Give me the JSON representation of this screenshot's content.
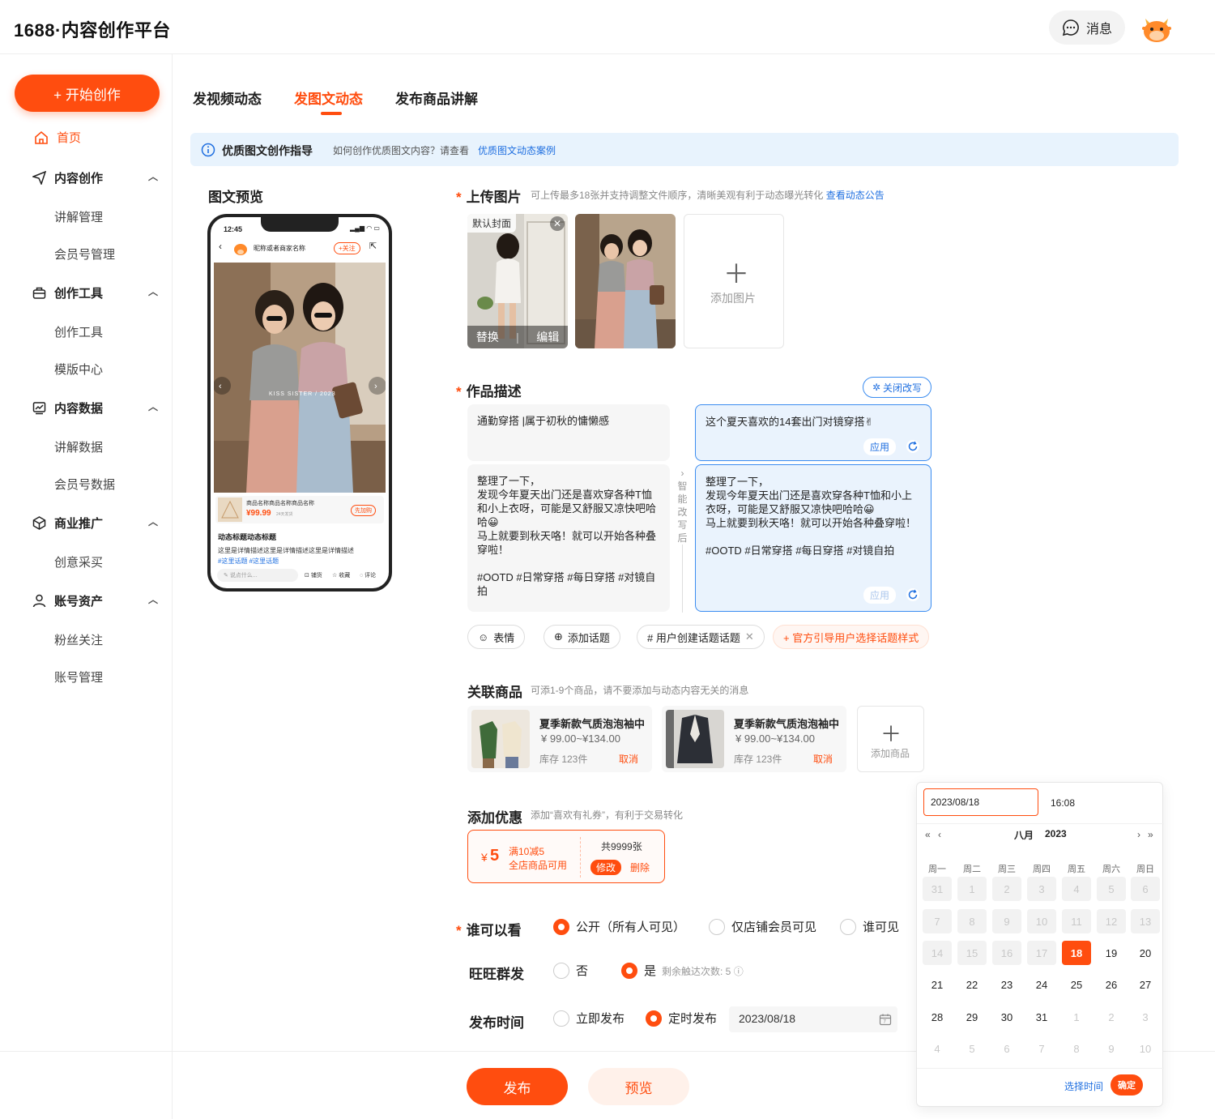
{
  "brand": "1688·内容创作平台",
  "header": {
    "message_label": "消息"
  },
  "sidebar": {
    "start_label": "+ 开始创作",
    "home": "首页",
    "groups": [
      {
        "label": "内容创作",
        "items": [
          "讲解管理",
          "会员号管理"
        ]
      },
      {
        "label": "创作工具",
        "items": [
          "创作工具",
          "模版中心"
        ]
      },
      {
        "label": "内容数据",
        "items": [
          "讲解数据",
          "会员号数据"
        ]
      },
      {
        "label": "商业推广",
        "items": [
          "创意采买"
        ]
      },
      {
        "label": "账号资产",
        "items": [
          "粉丝关注",
          "账号管理"
        ]
      }
    ]
  },
  "tabs": [
    "发视频动态",
    "发图文动态",
    "发布商品讲解"
  ],
  "notice": {
    "title": "优质图文创作指导",
    "text": "如何创作优质图文内容？请查看",
    "link": "优质图文动态案例"
  },
  "preview": {
    "title": "图文预览",
    "time": "12:45",
    "shop_name": "昵称或者商家名称",
    "follow": "+关注",
    "photo_text": "KISS SISTER / 2023",
    "product_name": "商品名称商品名称商品名称",
    "product_price": "¥99.99",
    "product_sub": "24天发货",
    "buy": "先加购",
    "post_title": "动态标题动态标题",
    "post_desc": "这里是详情描述这里是详情描述这里是详情描述",
    "post_tags": "#这里话题 #这里话题",
    "comment_placeholder": "说点什么...",
    "actions": [
      "铺货",
      "收藏",
      "评论"
    ]
  },
  "upload": {
    "label": "上传图片",
    "hint": "可上传最多18张并支持调整文件顺序，清晰美观有利于动态曝光转化",
    "hint_link": "查看动态公告",
    "cover_tag": "默认封面",
    "replace": "替换",
    "edit": "编辑",
    "add_label": "添加图片"
  },
  "desc": {
    "label": "作品描述",
    "close_rewrite": "关闭改写",
    "title_input": "通勤穿搭 |属于初秋的慵懒感",
    "title_suggest": "这个夏天喜欢的14套出门对镜穿搭✌",
    "body_input": [
      "整理了一下，",
      "发现今年夏天出门还是喜欢穿各种T恤和小上衣呀，可能是又舒服又凉快吧哈哈😀",
      "马上就要到秋天咯！就可以开始各种叠穿啦！",
      "",
      "#OOTD #日常穿搭 #每日穿搭 #对镜自拍"
    ],
    "body_suggest": [
      "整理了一下，",
      "发现今年夏天出门还是喜欢穿各种T恤和小上衣呀，可能是又舒服又凉快吧哈哈😀",
      "马上就要到秋天咯！就可以开始各种叠穿啦！",
      "",
      "#OOTD #日常穿搭 #每日穿搭 #对镜自拍"
    ],
    "divider_text": "智能改写后",
    "apply": "应用",
    "chips": [
      "表情",
      "添加话题",
      "# 用户创建话题话题",
      "+ 官方引导用户选择话题样式"
    ]
  },
  "products": {
    "label": "关联商品",
    "hint": "可添1-9个商品，请不要添加与动态内容无关的消息",
    "items": [
      {
        "title": "夏季新款气质泡泡袖中",
        "price": "¥ 99.00~¥134.00",
        "stock": "库存 123件",
        "cancel": "取消"
      },
      {
        "title": "夏季新款气质泡泡袖中",
        "price": "¥ 99.00~¥134.00",
        "stock": "库存 123件",
        "cancel": "取消"
      }
    ],
    "add_label": "添加商品"
  },
  "coupon": {
    "label": "添加优惠",
    "hint": "添加“喜欢有礼券”，有利于交易转化",
    "currency": "¥",
    "amount": "5",
    "rule": "满10减5",
    "scope": "全店商品可用",
    "total": "共9999张",
    "edit": "修改",
    "delete": "删除"
  },
  "visibility": {
    "label": "谁可以看",
    "options": [
      "公开（所有人可见）",
      "仅店铺会员可见",
      "谁可见"
    ],
    "selected": 0
  },
  "wangwang": {
    "label": "旺旺群发",
    "options": [
      "否",
      "是"
    ],
    "selected": 1,
    "remain": "剩余触达次数: 5"
  },
  "publish_time": {
    "label": "发布时间",
    "options": [
      "立即发布",
      "定时发布"
    ],
    "selected": 1,
    "date": "2023/08/18"
  },
  "buttons": {
    "publish": "发布",
    "preview": "预览"
  },
  "calendar": {
    "input": "2023/08/18",
    "time": "16:08",
    "month": "八月",
    "year": "2023",
    "weekdays": [
      "周一",
      "周二",
      "周三",
      "周四",
      "周五",
      "周六",
      "周日"
    ],
    "days": [
      "31",
      "1",
      "2",
      "3",
      "4",
      "5",
      "6",
      "7",
      "8",
      "9",
      "10",
      "11",
      "12",
      "13",
      "14",
      "15",
      "16",
      "17",
      "18",
      "19",
      "20",
      "21",
      "22",
      "23",
      "24",
      "25",
      "26",
      "27",
      "28",
      "29",
      "30",
      "31",
      "1",
      "2",
      "3",
      "4",
      "5",
      "6",
      "7",
      "8",
      "9",
      "10"
    ],
    "selected": "18",
    "select_time": "选择时间",
    "confirm": "确定",
    "accent": "#ff4d0f"
  }
}
